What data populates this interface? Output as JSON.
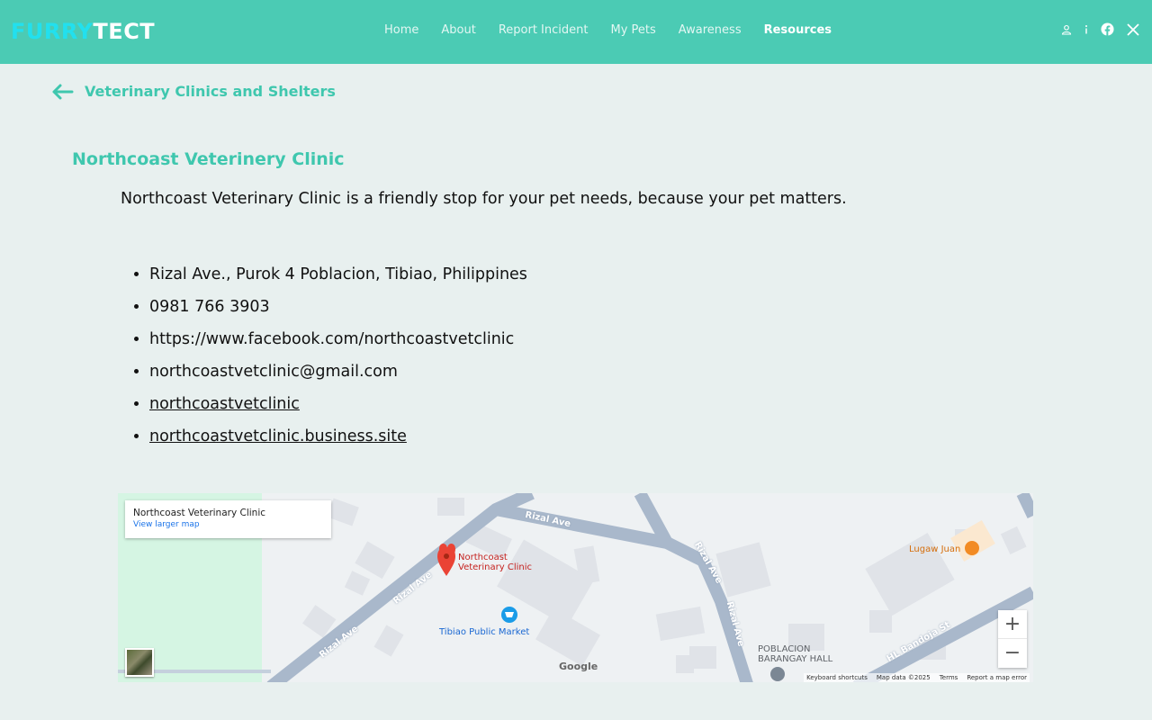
{
  "header": {
    "logo_part1": "FURRY",
    "logo_part2": "TECT",
    "nav": [
      {
        "label": "Home"
      },
      {
        "label": "About"
      },
      {
        "label": "Report Incident"
      },
      {
        "label": "My Pets"
      },
      {
        "label": "Awareness"
      },
      {
        "label": "Resources",
        "active": true
      }
    ],
    "icons": [
      "user-icon",
      "info-icon",
      "facebook-icon",
      "x-icon"
    ],
    "colors": {
      "bar": "#4bcbb4",
      "logo_accent": "#22e0ee",
      "heading": "#3fc7ae"
    }
  },
  "page": {
    "back_icon": "arrow-left-icon",
    "title": "Veterinary Clinics and Shelters"
  },
  "clinic": {
    "name": "Northcoast Veterinery Clinic",
    "description": "Northcoast Veterinary Clinic is a friendly stop for your pet needs, because your pet matters.",
    "details": [
      {
        "text": "Rizal Ave., Purok 4 Poblacion, Tibiao, Philippines",
        "link": false
      },
      {
        "text": "0981 766 3903",
        "link": false
      },
      {
        "text": "https://www.facebook.com/northcoastvetclinic",
        "link": false
      },
      {
        "text": "northcoastvetclinic@gmail.com",
        "link": false
      },
      {
        "text": "northcoastvetclinic",
        "link": true
      },
      {
        "text": "northcoastvetclinic.business.site",
        "link": true
      }
    ]
  },
  "map": {
    "card_title": "Northcoast Veterinary Clinic",
    "card_link": "View larger map",
    "pin_label_line1": "Northcoast",
    "pin_label_line2": "Veterinary Clinic",
    "road_labels": [
      "Rizal Ave",
      "Rizal Ave",
      "Rizal Ave",
      "Rizal Ave",
      "Rizal Ave",
      "HL Bandoja St"
    ],
    "poi_market": "Tibiao Public Market",
    "poi_restaurant": "Lugaw Juan",
    "poi_hall_line1": "POBLACION",
    "poi_hall_line2": "BARANGAY HALL",
    "google": "Google",
    "zoom_in": "+",
    "zoom_out": "−",
    "footer": [
      "Keyboard shortcuts",
      "Map data ©2025",
      "Terms",
      "Report a map error"
    ]
  }
}
